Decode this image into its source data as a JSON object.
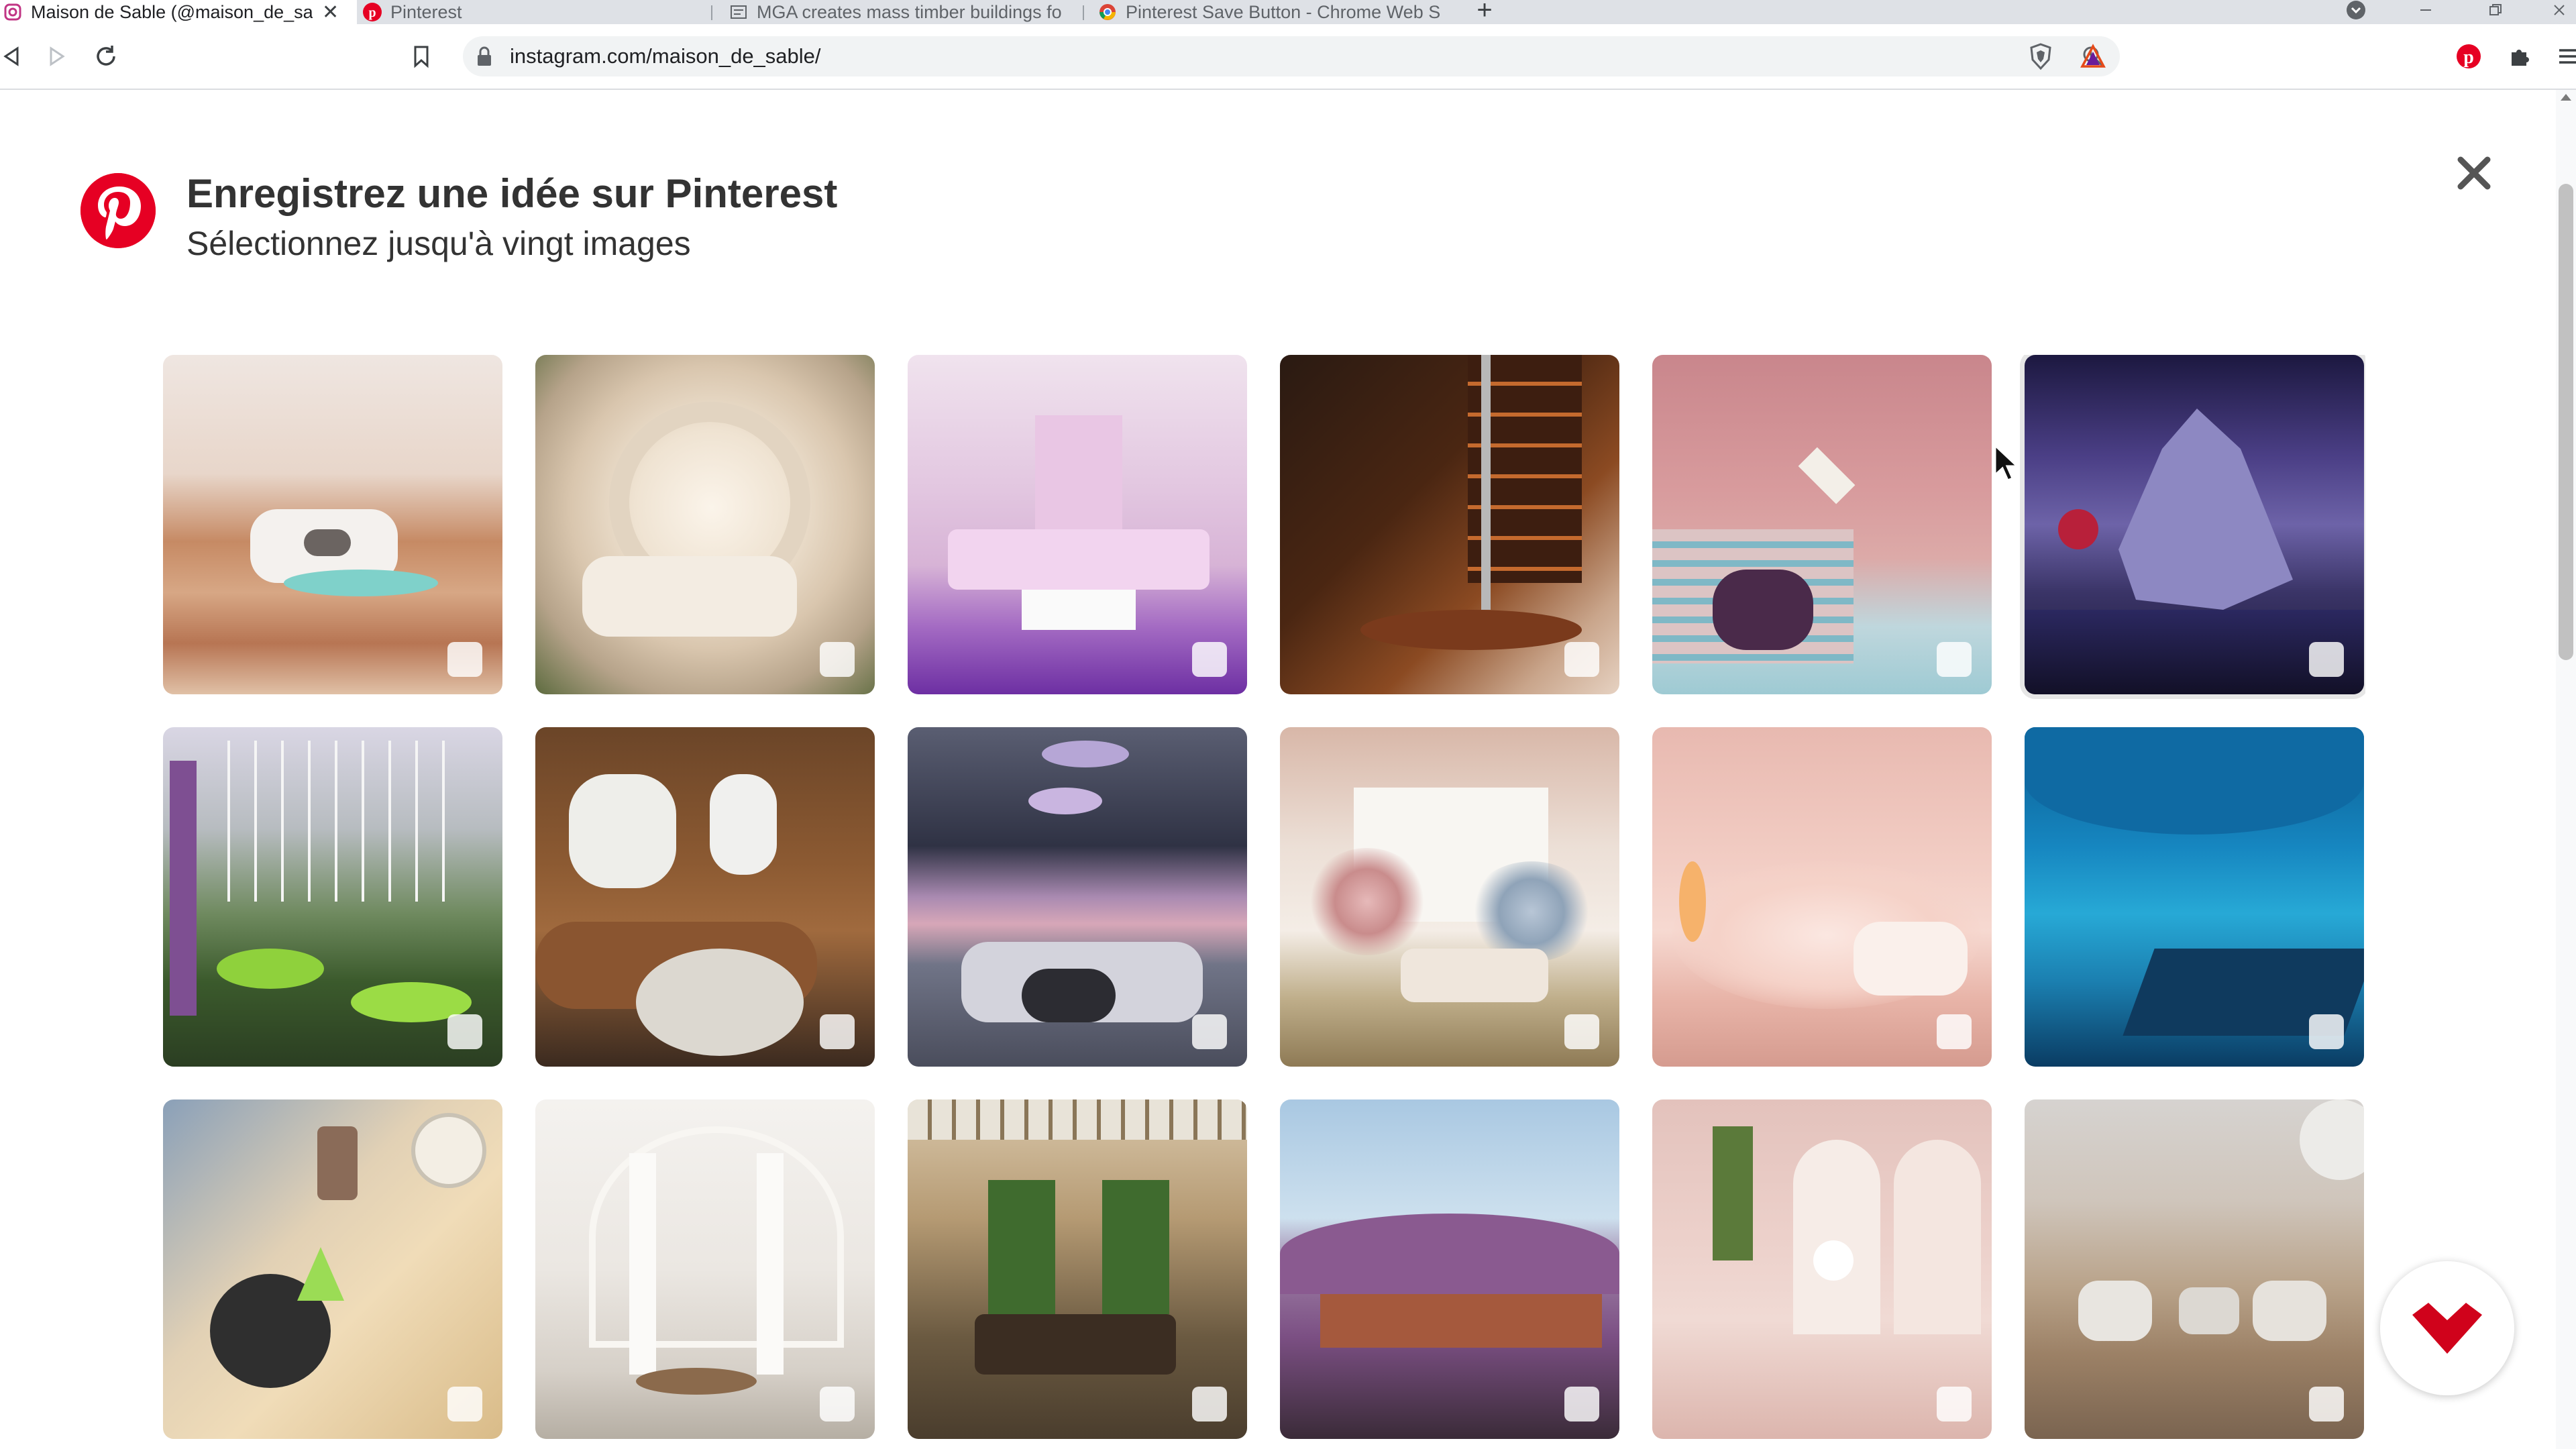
{
  "browser": {
    "tabs": [
      {
        "label": "Maison de Sable (@maison_de_sa",
        "icon": "instagram-icon",
        "active": true
      },
      {
        "label": "Pinterest",
        "icon": "pinterest-icon",
        "active": false
      },
      {
        "label": "MGA creates mass timber buildings fo",
        "icon": "site-favicon-icon",
        "active": false
      },
      {
        "label": "Pinterest Save Button - Chrome Web S",
        "icon": "chrome-web-store-icon",
        "active": false
      }
    ],
    "new_tab_label": "+",
    "close_glyph": "✕",
    "url": "instagram.com/maison_de_sable/"
  },
  "dialog": {
    "title": "Enregistrez une idée sur Pinterest",
    "subtitle": "Sélectionnez jusqu'à vingt images",
    "close_glyph": "✕",
    "brand_color": "#e60023"
  },
  "grid": {
    "columns": 6,
    "selected_count": 0,
    "images": [
      {
        "subject": "desert-house-pool",
        "hovered": false
      },
      {
        "subject": "round-cream-bedroom",
        "hovered": false
      },
      {
        "subject": "pink-lounge-sofa",
        "hovered": false
      },
      {
        "subject": "dark-shelves-fireplace",
        "hovered": false
      },
      {
        "subject": "pink-stairs-lamp",
        "hovered": false
      },
      {
        "subject": "purple-rock-lake",
        "hovered": true
      },
      {
        "subject": "greenhouse-lily-pads",
        "hovered": false
      },
      {
        "subject": "brown-airship-lounge",
        "hovered": false
      },
      {
        "subject": "spaceship-sunset-cabin",
        "hovered": false
      },
      {
        "subject": "floral-living-room",
        "hovered": false
      },
      {
        "subject": "pink-cloud-room",
        "hovered": false
      },
      {
        "subject": "underwater-bed",
        "hovered": false
      },
      {
        "subject": "gold-side-tables",
        "hovered": false
      },
      {
        "subject": "white-curtain-pavilion",
        "hovered": false
      },
      {
        "subject": "classic-hall-sofa",
        "hovered": false
      },
      {
        "subject": "lavender-field",
        "hovered": false
      },
      {
        "subject": "pink-arch-hallway",
        "hovered": false
      },
      {
        "subject": "desert-moon-chairs",
        "hovered": false
      }
    ]
  }
}
